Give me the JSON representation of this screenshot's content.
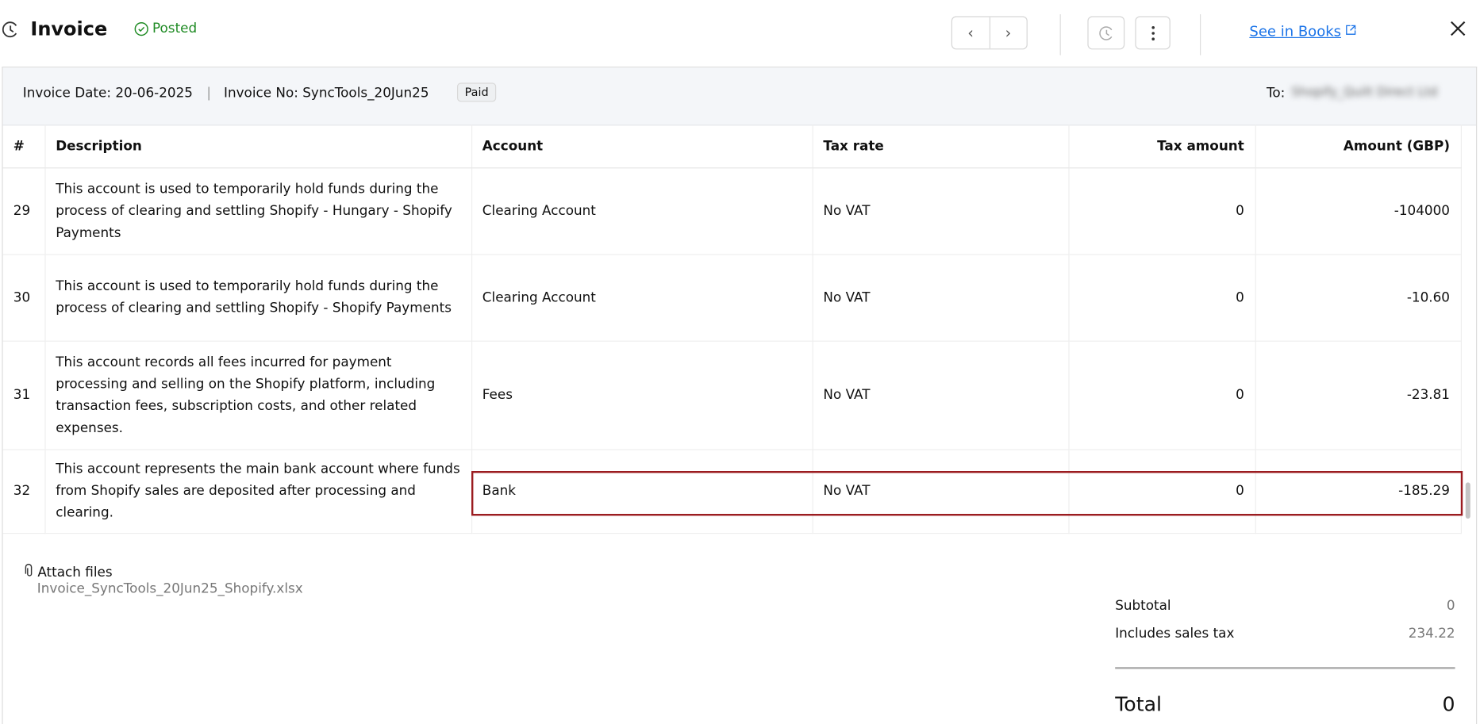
{
  "header": {
    "title": "Invoice",
    "status": "Posted",
    "see_in_books": "See in Books",
    "prev_label": "‹",
    "next_label": "›"
  },
  "info": {
    "invoice_date": "Invoice Date: 20-06-2025",
    "separator": "|",
    "invoice_no": "Invoice No: SyncTools_20Jun25",
    "badge": "Paid",
    "to_label": "To:",
    "to_value": "Shopify_Quilt Direct Ltd"
  },
  "table": {
    "columns": [
      "#",
      "Description",
      "Account",
      "Tax rate",
      "Tax amount",
      "Amount (GBP)"
    ],
    "rows": [
      {
        "num": "29",
        "description": "This account is used to temporarily hold funds during the process of clearing and settling Shopify - Hungary - Shopify Payments",
        "account": "Clearing Account",
        "tax_rate": "No VAT",
        "tax_amount": "0",
        "amount": "-104000"
      },
      {
        "num": "30",
        "description": "This account is used to temporarily hold funds during the process of clearing and settling Shopify - Shopify Payments",
        "account": "Clearing Account",
        "tax_rate": "No VAT",
        "tax_amount": "0",
        "amount": "-10.60"
      },
      {
        "num": "31",
        "description": "This account records all fees incurred for payment processing and selling on the Shopify platform, including transaction fees, subscription costs, and other related expenses.",
        "account": "Fees",
        "tax_rate": "No VAT",
        "tax_amount": "0",
        "amount": "-23.81"
      },
      {
        "num": "32",
        "description": "This account represents the main bank account where funds from Shopify sales are deposited after processing and clearing.",
        "account": "Bank",
        "tax_rate": "No VAT",
        "tax_amount": "0",
        "amount": "-185.29"
      }
    ]
  },
  "attachments": {
    "label": "Attach files",
    "file": "Invoice_SyncTools_20Jun25_Shopify.xlsx"
  },
  "totals": {
    "subtotal_label": "Subtotal",
    "subtotal": "0",
    "tax_label": "Includes sales tax",
    "tax": "234.22",
    "total_label": "Total",
    "total": "0"
  },
  "colors": {
    "posted": "#1f8b24",
    "link": "#1a73e8",
    "highlight": "#9b1c20"
  }
}
